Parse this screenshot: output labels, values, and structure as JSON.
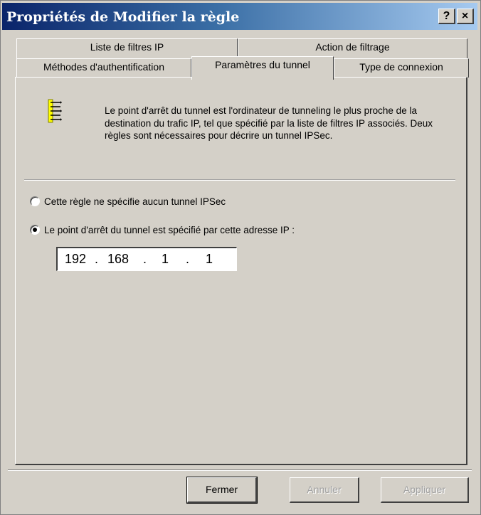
{
  "window": {
    "title": "Propriétés de Modifier la règle",
    "help_button": "?",
    "close_button": "×"
  },
  "tabs": {
    "row1": [
      "Liste de filtres IP",
      "Action de filtrage"
    ],
    "row2": [
      "Méthodes d'authentification",
      "Paramètres du tunnel",
      "Type de connexion"
    ],
    "active": "Paramètres du tunnel"
  },
  "panel": {
    "icon": "tunnel-icon",
    "description": "Le point d'arrêt du tunnel est l'ordinateur de tunneling le plus proche de la destination du trafic IP, tel que spécifié par la liste de filtres IP associés. Deux règles sont nécessaires pour décrire un tunnel IPSec.",
    "option_none": "Cette règle ne spécifie aucun tunnel IPSec",
    "option_ip": "Le point d'arrêt du tunnel est spécifié par cette adresse IP :",
    "selected_option": "option_ip",
    "ip_octets": [
      "192",
      "168",
      "1",
      "1"
    ]
  },
  "buttons": {
    "close": "Fermer",
    "cancel": "Annuler",
    "apply": "Appliquer"
  },
  "colors": {
    "title_gradient_start": "#0a246a",
    "title_gradient_end": "#a6caf0",
    "dialog_bg": "#d4d0c8",
    "icon_yellow": "#ffff00"
  }
}
